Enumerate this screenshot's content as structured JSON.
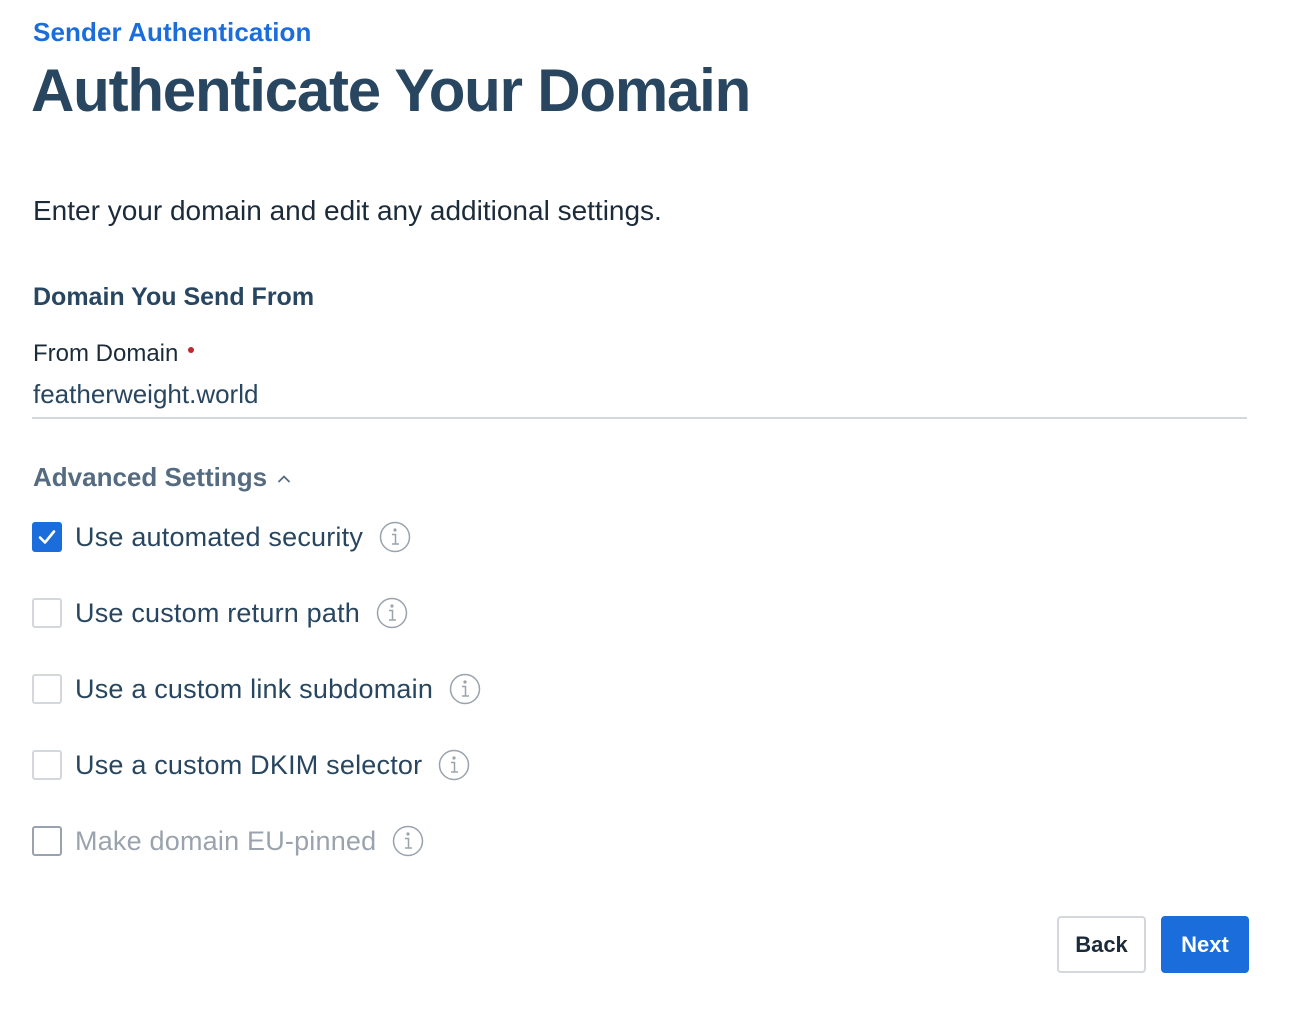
{
  "header": {
    "breadcrumb": "Sender Authentication",
    "title": "Authenticate Your Domain"
  },
  "intro": "Enter your domain and edit any additional settings.",
  "domain_section": {
    "heading": "Domain You Send From",
    "field_label": "From Domain",
    "field_value": "featherweight.world",
    "required": true
  },
  "advanced": {
    "label": "Advanced Settings",
    "expanded": true,
    "options": [
      {
        "label": "Use automated security",
        "checked": true,
        "disabled": false
      },
      {
        "label": "Use custom return path",
        "checked": false,
        "disabled": false
      },
      {
        "label": "Use a custom link subdomain",
        "checked": false,
        "disabled": false
      },
      {
        "label": "Use a custom DKIM selector",
        "checked": false,
        "disabled": false
      },
      {
        "label": "Make domain EU-pinned",
        "checked": false,
        "disabled": true
      }
    ]
  },
  "actions": {
    "back_label": "Back",
    "next_label": "Next"
  },
  "colors": {
    "accent": "#1a6ddb",
    "heading": "#294661",
    "required": "#c2272d",
    "muted": "#9aa3ad"
  }
}
